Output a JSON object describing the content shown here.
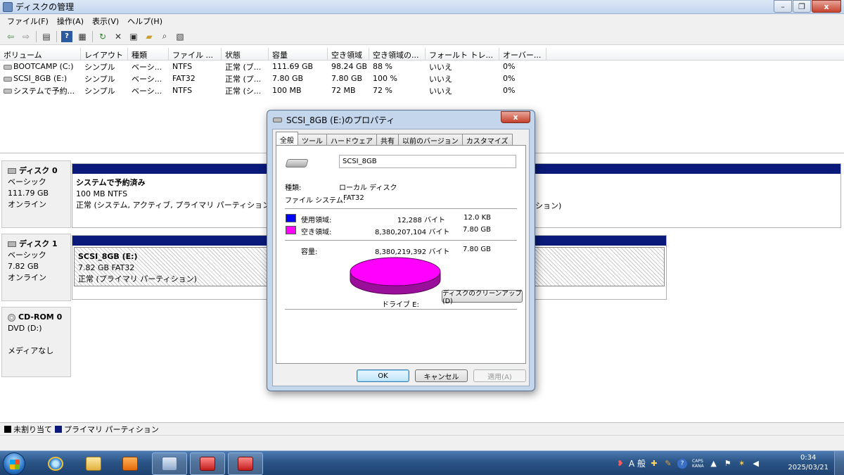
{
  "window": {
    "title": "ディスクの管理"
  },
  "menu": [
    "ファイル(F)",
    "操作(A)",
    "表示(V)",
    "ヘルプ(H)"
  ],
  "volume_table": {
    "columns": [
      "ボリューム",
      "レイアウト",
      "種類",
      "ファイル ...",
      "状態",
      "容量",
      "空き領域",
      "空き領域の...",
      "フォールト トレ...",
      "オーバー..."
    ],
    "rows": [
      [
        "BOOTCAMP (C:)",
        "シンプル",
        "ベーシ...",
        "NTFS",
        "正常 (ブ...",
        "111.69 GB",
        "98.24 GB",
        "88 %",
        "いいえ",
        "0%"
      ],
      [
        "SCSI_8GB (E:)",
        "シンプル",
        "ベーシ...",
        "FAT32",
        "正常 (プ...",
        "7.80 GB",
        "7.80 GB",
        "100 %",
        "いいえ",
        "0%"
      ],
      [
        "システムで予約...",
        "シンプル",
        "ベーシ...",
        "NTFS",
        "正常 (シ...",
        "100 MB",
        "72 MB",
        "72 %",
        "いいえ",
        "0%"
      ]
    ]
  },
  "disks": [
    {
      "name": "ディスク 0",
      "type": "ベーシック",
      "size": "111.79 GB",
      "status": "オンライン",
      "part_name": "システムで予約済み",
      "part_size": "100 MB NTFS",
      "part_status": "正常 (システム, アクティブ, プライマリ パーティション)",
      "right_status_tail": "ション)"
    },
    {
      "name": "ディスク 1",
      "type": "ベーシック",
      "size": "7.82 GB",
      "status": "オンライン",
      "part_name": "SCSI_8GB  (E:)",
      "part_size": "7.82 GB FAT32",
      "part_status": "正常 (プライマリ パーティション)"
    },
    {
      "name": "CD-ROM 0",
      "type": "DVD (D:)",
      "status": "メディアなし"
    }
  ],
  "legend": {
    "unallocated": "未割り当て",
    "primary": "プライマリ パーティション",
    "unallocated_color": "#000000",
    "primary_color": "#0a1a7a"
  },
  "dialog": {
    "title": "SCSI_8GB (E:)のプロパティ",
    "close_label": "x",
    "tabs": [
      "全般",
      "ツール",
      "ハードウェア",
      "共有",
      "以前のバージョン",
      "カスタマイズ"
    ],
    "volume_label": "SCSI_8GB",
    "type_label": "種類:",
    "type_value": "ローカル ディスク",
    "fs_label": "ファイル システム:",
    "fs_value": "FAT32",
    "used_label": "使用領域:",
    "used_bytes": "12,288 バイト",
    "used_size": "12.0 KB",
    "used_color": "#0000ff",
    "free_label": "空き領域:",
    "free_bytes": "8,380,207,104 バイト",
    "free_size": "7.80 GB",
    "free_color": "#ff00ff",
    "capacity_label": "容量:",
    "capacity_bytes": "8,380,219,392 バイト",
    "capacity_size": "7.80 GB",
    "drive_label": "ドライブ E:",
    "cleanup_button": "ディスクのクリーンアップ(D)",
    "ok": "OK",
    "cancel": "キャンセル",
    "apply": "適用(A)"
  },
  "taskbar": {
    "ime": "A 般",
    "caps": "CAPS",
    "kana": "KANA",
    "time": "0:34",
    "date": "2025/03/21"
  }
}
